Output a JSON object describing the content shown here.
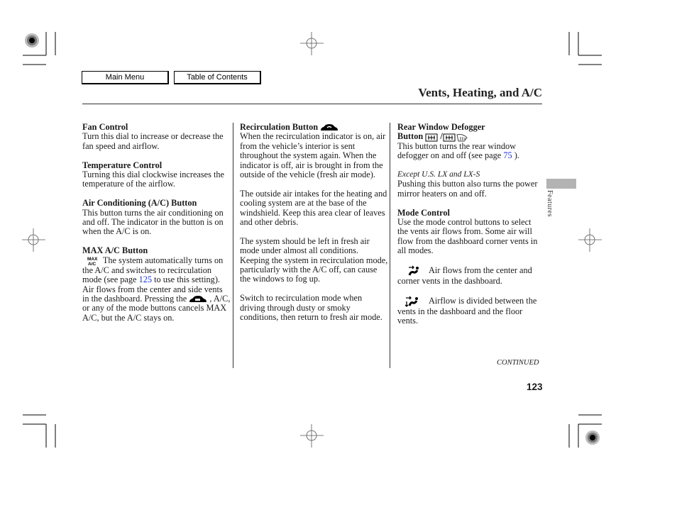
{
  "nav": {
    "main_menu_label": "Main Menu",
    "toc_label": "Table of Contents"
  },
  "header": {
    "title": "Vents, Heating, and A/C"
  },
  "side_tab": {
    "label": "Features",
    "color": "#b3b3b3"
  },
  "columns": {
    "col1": {
      "fan_heading": "Fan Control",
      "fan_text": "Turn this dial to increase or decrease the fan speed and airflow.",
      "temp_heading": "Temperature Control",
      "temp_text": "Turning this dial clockwise increases the temperature of the airflow.",
      "ac_heading": "Air Conditioning (A/C) Button",
      "ac_text": "This button turns the air conditioning on and off. The indicator in the button is on when the A/C is on.",
      "max_heading": "MAX A/C Button",
      "max_icon": "max-ac-icon",
      "max_text_1": " The system automatically turns on the A/C and switches to recirculation mode (see page ",
      "max_link": "125",
      "max_text_2": " to use this setting). Air flows from the center and side vents in the dashboard. Pressing the ",
      "max_recirc_icon": "recirculation-icon",
      "max_text_3": " , A/C, or any of the mode buttons cancels MAX A/C, but the A/C stays on."
    },
    "col2": {
      "recirc_heading": "Recirculation Button",
      "recirc_icon": "recirculation-icon",
      "recirc_text": "When the recirculation indicator is on, air from the vehicle’s interior is sent throughout the system again. When the indicator is off, air is brought in from the outside of the vehicle (fresh air mode).",
      "intake_text": "The outside air intakes for the heating and cooling system are at the base of the windshield. Keep this area clear of leaves and other debris.",
      "fresh_text": "The system should be left in fresh air mode under almost all conditions. Keeping the system in recirculation mode, particularly with the A/C off, can cause the windows to fog up.",
      "switch_text": "Switch to recirculation mode when driving through dusty or smoky conditions, then return to fresh air mode."
    },
    "col3": {
      "defog_heading_1": "Rear Window Defogger",
      "defog_heading_2": "Button",
      "defog_icons": [
        "rear-defogger-icon",
        "mirror-heater-icon"
      ],
      "defog_text_1": "This button turns the rear window defogger on and off (see page ",
      "defog_link": "75",
      "defog_text_2": " ).",
      "except_note": "Except U.S. LX and LX-S",
      "mirror_text": "Pushing this button also turns the power mirror heaters on and off.",
      "mode_heading": "Mode Control",
      "mode_text": "Use the mode control buttons to select the vents air flows from. Some air will flow from the dashboard corner vents in all modes.",
      "mode_dash_icon": "dashboard-vents-icon",
      "mode_dash_text": "Air flows from the center and corner vents in the dashboard.",
      "mode_bilevel_icon": "bilevel-vents-icon",
      "mode_bilevel_text": "Airflow is divided between the vents in the dashboard and the floor vents."
    }
  },
  "footer": {
    "continued": "CONTINUED",
    "page_number": "123"
  },
  "colors": {
    "link": "#1a33cc",
    "text": "#1a1a1a"
  }
}
